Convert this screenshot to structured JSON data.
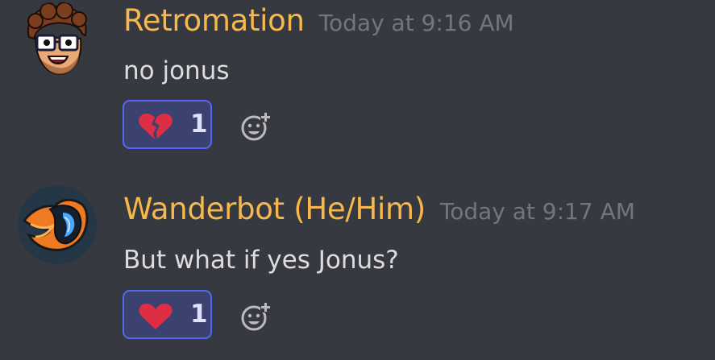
{
  "messages": [
    {
      "username": "Retromation",
      "timestamp": "Today at 9:16 AM",
      "content": "no jonus",
      "reaction": {
        "emoji": "broken-heart",
        "count": "1"
      }
    },
    {
      "username": "Wanderbot (He/Him)",
      "timestamp": "Today at 9:17 AM",
      "content": "But what if yes Jonus?",
      "reaction": {
        "emoji": "red-heart",
        "count": "1"
      }
    }
  ],
  "colors": {
    "background": "#36393f",
    "username": "#f9b84b",
    "timestamp": "#72767d",
    "content": "#dcddde",
    "reaction_border": "#5865f2",
    "reaction_bg": "#3c4270",
    "heart": "#dd2e44"
  }
}
